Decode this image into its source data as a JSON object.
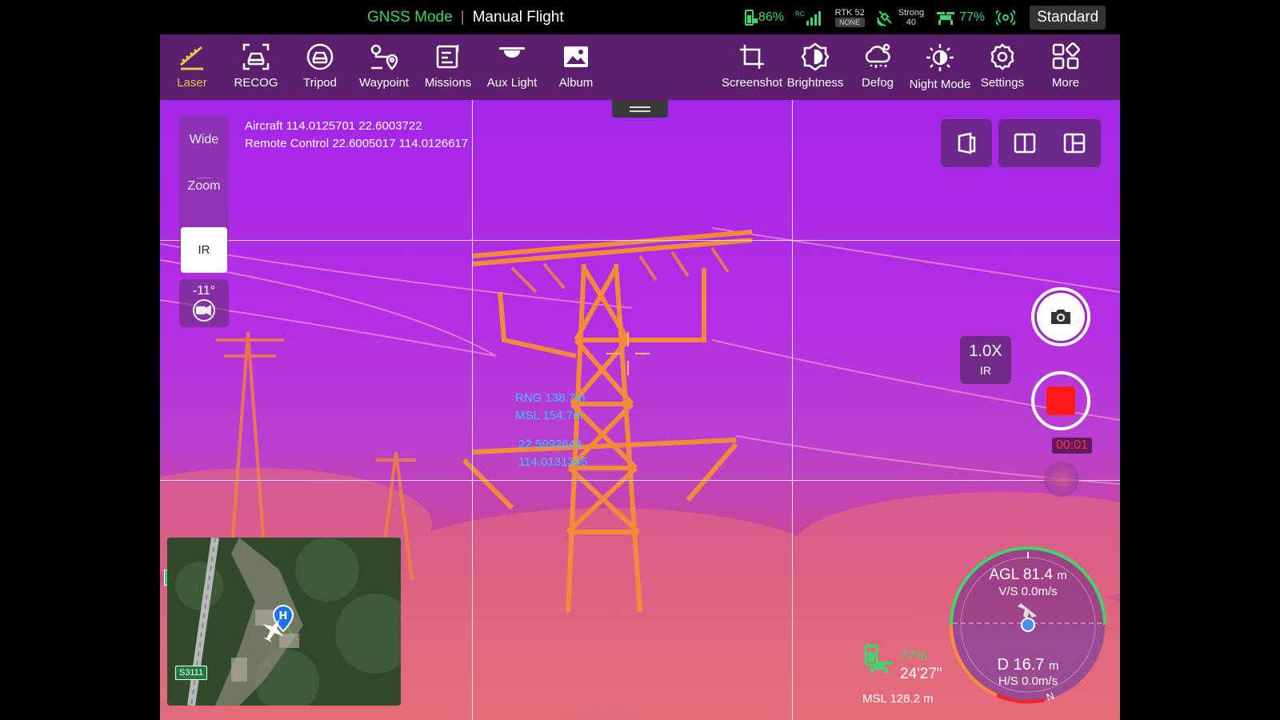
{
  "status": {
    "gnss_mode": "GNSS Mode",
    "separator": "|",
    "flight_mode": "Manual Flight",
    "aircraft_battery": "86%",
    "rc_label": "RC",
    "rtk_label": "RTK 52",
    "rtk_state": "NONE",
    "signal_label": "Strong",
    "signal_value": "40",
    "rc_battery": "77%",
    "profile": "Standard"
  },
  "toolbar": {
    "laser": "Laser",
    "recog": "RECOG",
    "tripod": "Tripod",
    "waypoint": "Waypoint",
    "missions": "Missions",
    "aux_light": "Aux Light",
    "album": "Album",
    "screenshot": "Screenshot",
    "brightness": "Brightness",
    "defog": "Defog",
    "night_mode": "Night Mode",
    "settings": "Settings",
    "more": "More"
  },
  "lens": {
    "wide": "Wide",
    "zoom": "Zoom",
    "ir": "IR",
    "selected": "IR"
  },
  "gimbal": {
    "pitch": "-11°"
  },
  "coords": {
    "aircraft": "Aircraft 114.0125701 22.6003722",
    "remote": "Remote Control 22.6005017 114.0126617"
  },
  "zoom": {
    "level": "1.0X",
    "mode": "IR"
  },
  "recording": {
    "time": "00:01"
  },
  "measure": {
    "rng": "RNG  138.7m",
    "msl": "MSL  154.7m",
    "lat": "22.5992643",
    "lon": "114.0131345"
  },
  "map": {
    "road_label": "S3111"
  },
  "telemetry": {
    "battery": "77%",
    "flight_time": "24'27\"",
    "msl": "MSL 128.2 m",
    "agl_label": "AGL",
    "agl_value": "81.4",
    "agl_unit": "m",
    "vs": "V/S 0.0m/s",
    "d_label": "D",
    "d_value": "16.7",
    "d_unit": "m",
    "hs": "H/S 0.0m/s",
    "north": "N"
  },
  "colors": {
    "accent_green": "#3ed66a",
    "toolbar_bg": "#5b1f6e",
    "active_tool": "#f1c34a",
    "measure_text": "#35c7ff",
    "record_red": "#ff1a1a",
    "thermal_hot": "#f38a3a"
  },
  "icons": [
    "battery-icon",
    "rc-signal-icon",
    "satellite-icon",
    "rc-battery-icon",
    "link-icon",
    "laser-icon",
    "recog-icon",
    "tripod-icon",
    "waypoint-icon",
    "missions-icon",
    "aux-light-icon",
    "album-icon",
    "screenshot-icon",
    "brightness-icon",
    "defog-icon",
    "night-mode-icon",
    "settings-icon",
    "more-icon"
  ]
}
